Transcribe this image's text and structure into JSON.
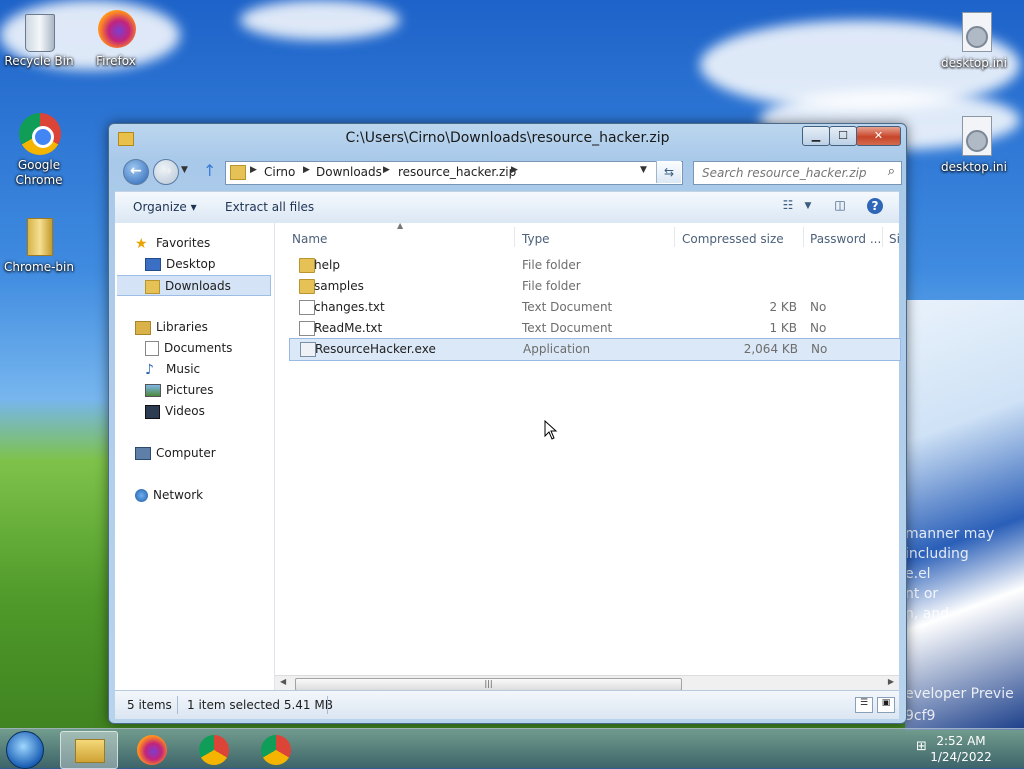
{
  "desktop": {
    "icons": [
      {
        "label": "Recycle Bin"
      },
      {
        "label": "Firefox"
      },
      {
        "label": "Google Chrome"
      },
      {
        "label": "Chrome-bin"
      },
      {
        "label": "desktop.ini"
      },
      {
        "label": "desktop.ini"
      }
    ],
    "wallpaper_text": [
      "manner may",
      "including",
      "e.el",
      "nt or",
      "n, and",
      "eveloper Previe",
      "9cf9"
    ]
  },
  "window": {
    "title": "C:\\Users\\Cirno\\Downloads\\resource_hacker.zip",
    "caption_buttons": {
      "minimize": "▁",
      "maximize": "☐",
      "close": "✕"
    }
  },
  "address": {
    "segments": [
      "Cirno",
      "Downloads",
      "resource_hacker.zip"
    ],
    "search_placeholder": "Search resource_hacker.zip"
  },
  "toolbar": {
    "organize": "Organize ▾",
    "extract": "Extract all files"
  },
  "navpane": {
    "favorites": "Favorites",
    "desktop": "Desktop",
    "downloads": "Downloads",
    "libraries": "Libraries",
    "documents": "Documents",
    "music": "Music",
    "pictures": "Pictures",
    "videos": "Videos",
    "computer": "Computer",
    "network": "Network"
  },
  "columns": {
    "name": "Name",
    "type": "Type",
    "compressed_size": "Compressed size",
    "password": "Password ...",
    "size_partial": "Si"
  },
  "files": [
    {
      "name": "help",
      "type": "File folder",
      "size": "",
      "password": "",
      "icon": "folder-icon"
    },
    {
      "name": "samples",
      "type": "File folder",
      "size": "",
      "password": "",
      "icon": "folder-icon"
    },
    {
      "name": "changes.txt",
      "type": "Text Document",
      "size": "2 KB",
      "password": "No",
      "icon": "text-file-icon"
    },
    {
      "name": "ReadMe.txt",
      "type": "Text Document",
      "size": "1 KB",
      "password": "No",
      "icon": "text-file-icon"
    },
    {
      "name": "ResourceHacker.exe",
      "type": "Application",
      "size": "2,064 KB",
      "password": "No",
      "icon": "application-icon"
    }
  ],
  "status": {
    "items": "5 items",
    "selected": "1 item selected  5.41 MB"
  },
  "clock": {
    "time": "2:52 AM",
    "date": "1/24/2022"
  }
}
